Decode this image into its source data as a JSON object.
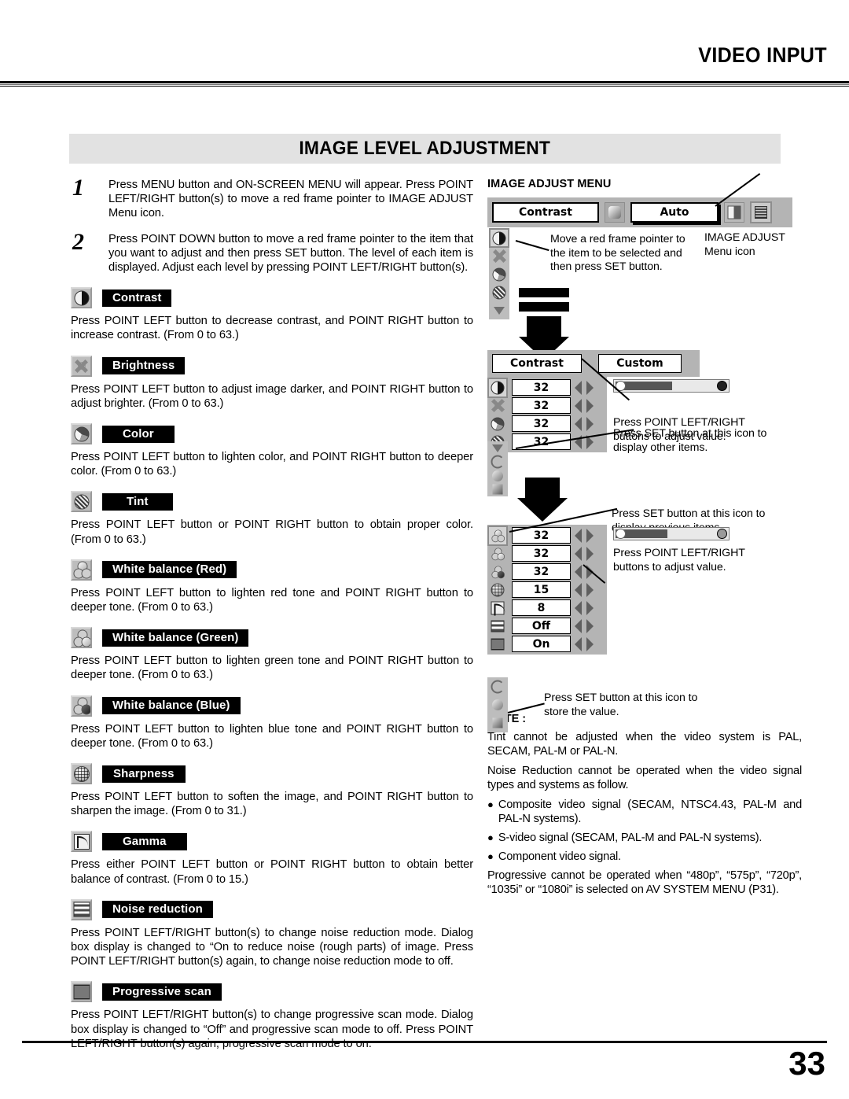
{
  "header": {
    "title": "VIDEO INPUT"
  },
  "section": {
    "banner_title": "IMAGE LEVEL ADJUSTMENT"
  },
  "footer": {
    "page_number": "33"
  },
  "steps": [
    {
      "number": "1",
      "text": "Press MENU button and ON-SCREEN MENU will appear.  Press POINT LEFT/RIGHT button(s) to move a red frame pointer to IMAGE ADJUST Menu icon."
    },
    {
      "number": "2",
      "text": "Press POINT DOWN button to move a red frame pointer to the item that you want to adjust and then press SET button.  The level of each item is displayed.  Adjust each level by pressing POINT LEFT/RIGHT button(s)."
    }
  ],
  "items": [
    {
      "icon": "contrast-icon",
      "label": "Contrast",
      "text": "Press POINT LEFT button to decrease contrast, and POINT RIGHT button to increase contrast.  (From 0 to 63.)"
    },
    {
      "icon": "brightness-icon",
      "label": "Brightness",
      "text": "Press POINT LEFT button to adjust image darker, and POINT RIGHT button to adjust brighter.  (From 0 to 63.)"
    },
    {
      "icon": "color-icon",
      "label": "Color",
      "text": "Press POINT LEFT button to lighten color, and POINT RIGHT button to deeper color.  (From 0 to 63.)"
    },
    {
      "icon": "tint-icon",
      "label": "Tint",
      "text": "Press POINT LEFT button or POINT RIGHT button to obtain proper color.  (From 0 to 63.)"
    },
    {
      "icon": "white-balance-red-icon",
      "label": "White balance (Red)",
      "text": "Press POINT LEFT button to lighten red tone and POINT RIGHT button to deeper tone.  (From 0 to 63.)"
    },
    {
      "icon": "white-balance-green-icon",
      "label": "White balance (Green)",
      "text": "Press POINT LEFT button to lighten green tone and POINT RIGHT button to deeper tone.  (From 0 to 63.)"
    },
    {
      "icon": "white-balance-blue-icon",
      "label": "White balance (Blue)",
      "text": "Press POINT LEFT button to lighten blue tone and POINT RIGHT button to deeper tone.  (From 0 to 63.)"
    },
    {
      "icon": "sharpness-icon",
      "label": "Sharpness",
      "text": "Press POINT LEFT button to soften the image, and POINT RIGHT button to sharpen the image.  (From 0 to 31.)"
    },
    {
      "icon": "gamma-icon",
      "label": "Gamma",
      "text": "Press either POINT LEFT button or POINT RIGHT button to obtain better balance of contrast.  (From 0 to 15.)"
    },
    {
      "icon": "noise-reduction-icon",
      "label": "Noise reduction",
      "text": "Press POINT LEFT/RIGHT button(s) to change noise reduction mode.  Dialog box display is changed to “On to reduce noise (rough parts) of  image. Press POINT LEFT/RIGHT button(s) again, to change noise reduction mode to off."
    },
    {
      "icon": "progressive-scan-icon",
      "label": "Progressive scan",
      "text": "Press POINT LEFT/RIGHT button(s) to change progressive scan mode.  Dialog box display is changed to “Off” and progressive scan mode to off. Press POINT LEFT/RIGHT button(s) again, progressive scan mode to on."
    }
  ],
  "diagram": {
    "title": "IMAGE ADJUST MENU",
    "menu_bar": {
      "title_field": "Contrast",
      "auto_field": "Auto",
      "shuffle_icon": "shuffle-icon",
      "image_icon": "image-icon",
      "image_adjust_icon": "image-adjust-icon"
    },
    "callout_menu_icon": "IMAGE ADJUST\nMenu icon",
    "callout_menu_icon_l1": "IMAGE ADJUST",
    "callout_menu_icon_l2": "Menu icon",
    "callout_pointer": "Move a red frame pointer to the item to be selected and then press SET button.",
    "panel2": {
      "title_field": "Contrast",
      "mode_field": "Custom",
      "values": [
        "32",
        "32",
        "32",
        "32"
      ],
      "icons": [
        "contrast-icon",
        "brightness-icon",
        "color-icon",
        "tint-icon"
      ],
      "callout_adjust": "Press POINT LEFT/RIGHT buttons to adjust value.",
      "callout_next": "Press SET button at this icon to display other items."
    },
    "panel3": {
      "values": [
        "32",
        "32",
        "32",
        "15",
        "8",
        "Off",
        "On"
      ],
      "icons": [
        "white-balance-red-icon",
        "white-balance-green-icon",
        "white-balance-blue-icon",
        "sharpness-icon",
        "gamma-icon",
        "noise-reduction-icon",
        "progressive-scan-icon"
      ],
      "callout_prev": "Press SET button at this icon to display previous items.",
      "callout_adjust": "Press POINT LEFT/RIGHT buttons to adjust value.",
      "callout_store": "Press SET button at this icon to store the value."
    }
  },
  "note": {
    "heading": "NOTE :",
    "p1": "Tint cannot be adjusted when the video system is PAL, SECAM, PAL-M or PAL-N.",
    "p2": "Noise Reduction cannot be operated when the video signal types and systems as follow.",
    "bullets": [
      "Composite video signal (SECAM, NTSC4.43, PAL-M and PAL-N systems).",
      "S-video signal (SECAM, PAL-M and PAL-N systems).",
      "Component video signal."
    ],
    "p3": "Progressive cannot be operated when “480p”, “575p”, “720p”, “1035i” or “1080i” is selected on AV SYSTEM MENU (P31)."
  }
}
